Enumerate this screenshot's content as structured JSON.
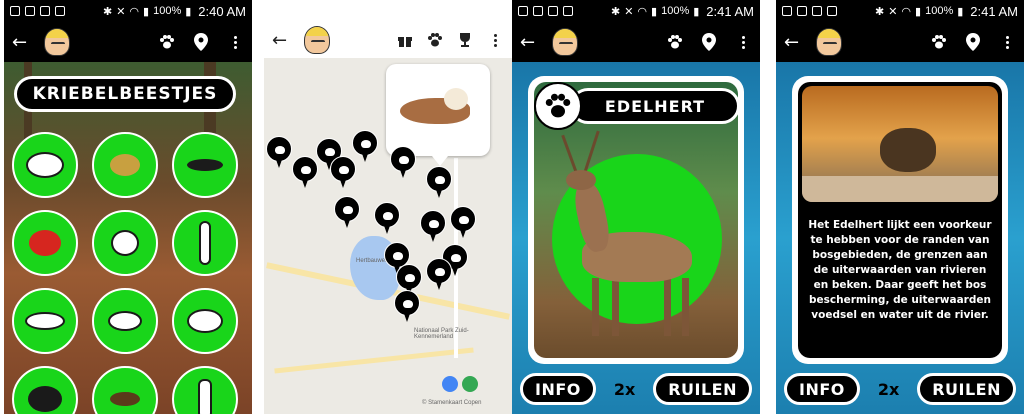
{
  "status_bar_1": {
    "battery": "100%",
    "time": "2:40 AM"
  },
  "status_bar_2": {
    "battery": "100%",
    "time": "2:41 AM"
  },
  "status_bar_3": {
    "battery": "100%",
    "time": "2:41 AM"
  },
  "screen1": {
    "category_title": "KRIEBELBEESTJES",
    "insects": [
      "insect-1",
      "insect-2",
      "insect-3",
      "insect-4",
      "insect-5",
      "insect-6",
      "insect-7",
      "insect-8",
      "insect-9",
      "insect-10",
      "insect-11",
      "insect-12"
    ]
  },
  "screen2": {
    "map_labels": {
      "lake": "Hertbauwerf",
      "park": "Nationaal Park Zuid-Kennemerland",
      "attribution": "© Stamenkaart Copen"
    }
  },
  "screen3": {
    "animal_name": "EDELHERT",
    "info_label": "INFO",
    "count_label": "2x",
    "trade_label": "RUILEN"
  },
  "screen4": {
    "description": "Het Edelhert lijkt een voorkeur te hebben voor de randen van bosgebieden, de grenzen aan de uiterwaarden van rivieren en beken. Daar geeft het bos bescherming, de uiterwaarden voedsel en water uit de rivier.",
    "info_label": "INFO",
    "count_label": "2x",
    "trade_label": "RUILEN"
  },
  "colors": {
    "accent_green": "#19d51a",
    "app_black": "#000000",
    "ocean_blue": "#2aa0cf"
  }
}
